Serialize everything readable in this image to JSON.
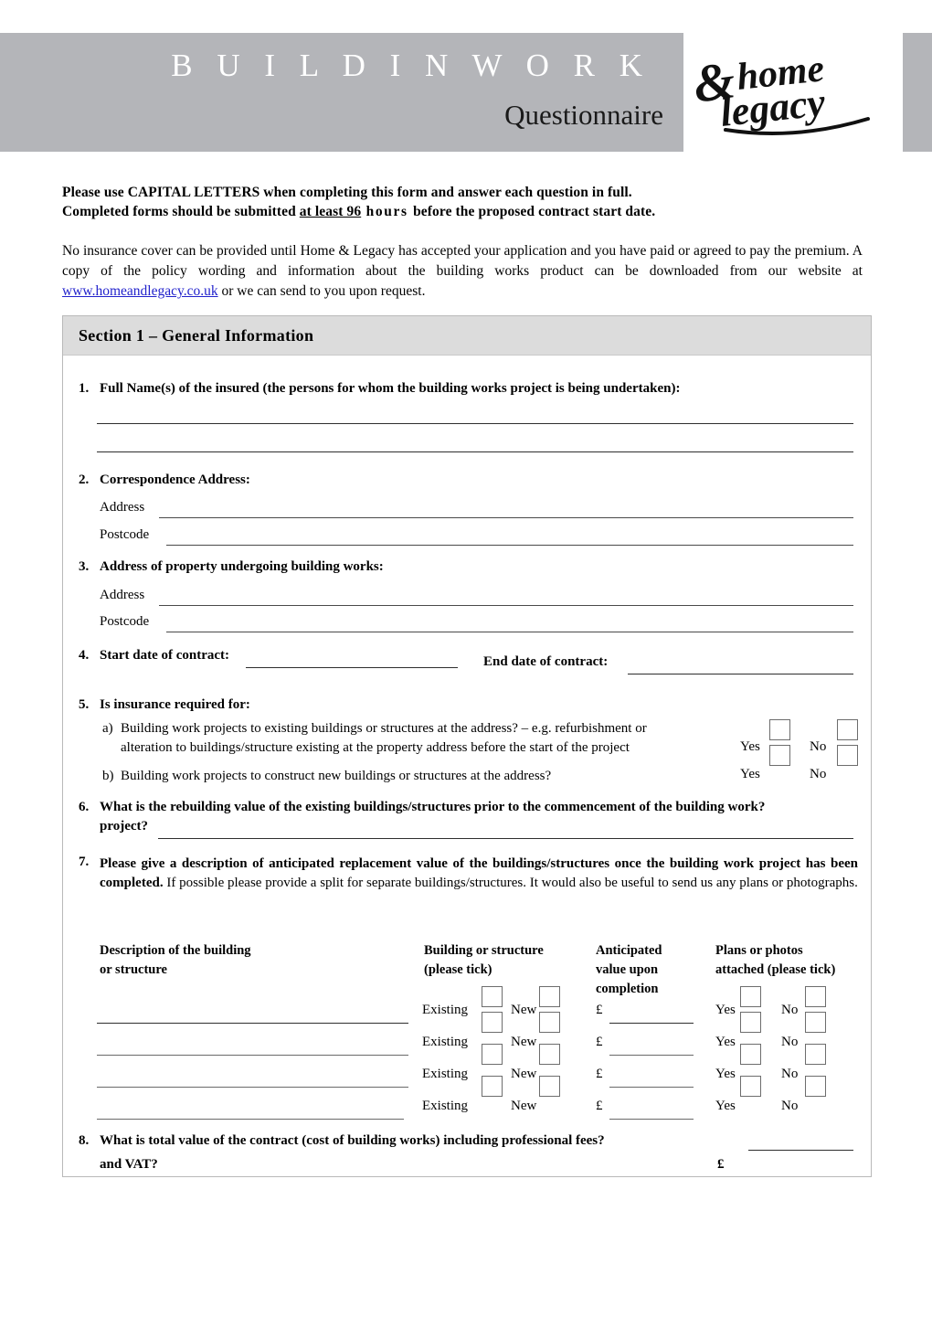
{
  "header": {
    "title": "B U I L D I N   W O R K",
    "title_plain": "BUILDIN WORK",
    "subtitle": "Questionnaire",
    "logo_word_1": "home",
    "logo_word_2": "legacy",
    "logo_ampersand": "&",
    "band_color": "#b4b5b9"
  },
  "intro": {
    "line1_a": "Please use CAPITAL LETTERS when completing this form and answer each question in full.",
    "line2_a": "Completed forms should be submitted ",
    "line2_underlined": "at  least  96",
    "line2_spaced": " hours ",
    "line2_b": "before the proposed contract start date",
    "line2_end": ".",
    "body_a": "No insurance cover can be provided until Home & Legacy has accepted your application and you have paid or agreed to pay the premium. A copy of the policy wording and information about the building works product can be downloaded from our website at ",
    "link_text": "www.homeandlegacy.co.uk",
    "body_b": " or we can send to you upon request.",
    "link_color": "#2222cc"
  },
  "section": {
    "header_title": "Section 1 – General Information",
    "header_bg": "#dcdcdc"
  },
  "questions": [
    {
      "num": "1.",
      "text": "Full Name(s) of the insured (the persons for whom the building works project is being undertaken):"
    },
    {
      "num": "2.",
      "text": "Correspondence Address:",
      "address_label": "Address",
      "postcode_label": "Postcode"
    },
    {
      "num": "3.",
      "text": "Address of property undergoing building works:",
      "address_label": "Address",
      "postcode_label": "Postcode"
    },
    {
      "num": "4.",
      "start_label": "Start date of contract:",
      "end_label": "End date of contract:"
    },
    {
      "num": "5.",
      "text": "Is insurance required for:",
      "a_marker": "a)",
      "a_line1": "Building work projects to existing buildings or structures at the address? – e.g. refurbishment  or",
      "a_line2": "alteration to buildings/structure existing at the property  address  before the start  of the project",
      "b_marker": "b)",
      "b_line1": "Building work projects to construct new buildings or structures at the address?",
      "yes_label": "Yes",
      "no_label": "No"
    },
    {
      "num": "6.",
      "line1": "What is the rebuilding value of the existing buildings/structures prior to the commencement of the building work?",
      "line2": "project?"
    },
    {
      "num": "7.",
      "bold_part": "Please give a description of anticipated replacement value of the buildings/structures once the building work project has been completed.",
      "regular_part": " If possible please provide a split for separate buildings/structures. It would also be useful to send us any plans or photographs."
    },
    {
      "num": "8.",
      "line1": "What is total value of the contract (cost of building works) including professional fees?",
      "line2": "and VAT?",
      "currency": "£"
    }
  ],
  "table": {
    "col1_line1": "Description of the building",
    "col1_line2": "or structure",
    "col2_line1": "Building or structure",
    "col2_line2": "(please tick)",
    "col3_line1": "Anticipated",
    "col3_line2": "value upon",
    "col3_line3": "completion",
    "col4_line1": "Plans or photos",
    "col4_line2": "attached (please tick)",
    "existing_label": "Existing",
    "new_label": "New",
    "currency": "£",
    "yes_label": "Yes",
    "no_label": "No",
    "rows": [
      {
        "existing": "Existing",
        "new": "New",
        "currency": "£",
        "yes": "Yes",
        "no": "No"
      },
      {
        "existing": "Existing",
        "new": "New",
        "currency": "£",
        "yes": "Yes",
        "no": "No"
      },
      {
        "existing": "Existing",
        "new": "New",
        "currency": "£",
        "yes": "Yes",
        "no": "No"
      },
      {
        "existing": "Existing",
        "new": "New",
        "currency": "£",
        "yes": "Yes",
        "no": "No"
      }
    ]
  }
}
